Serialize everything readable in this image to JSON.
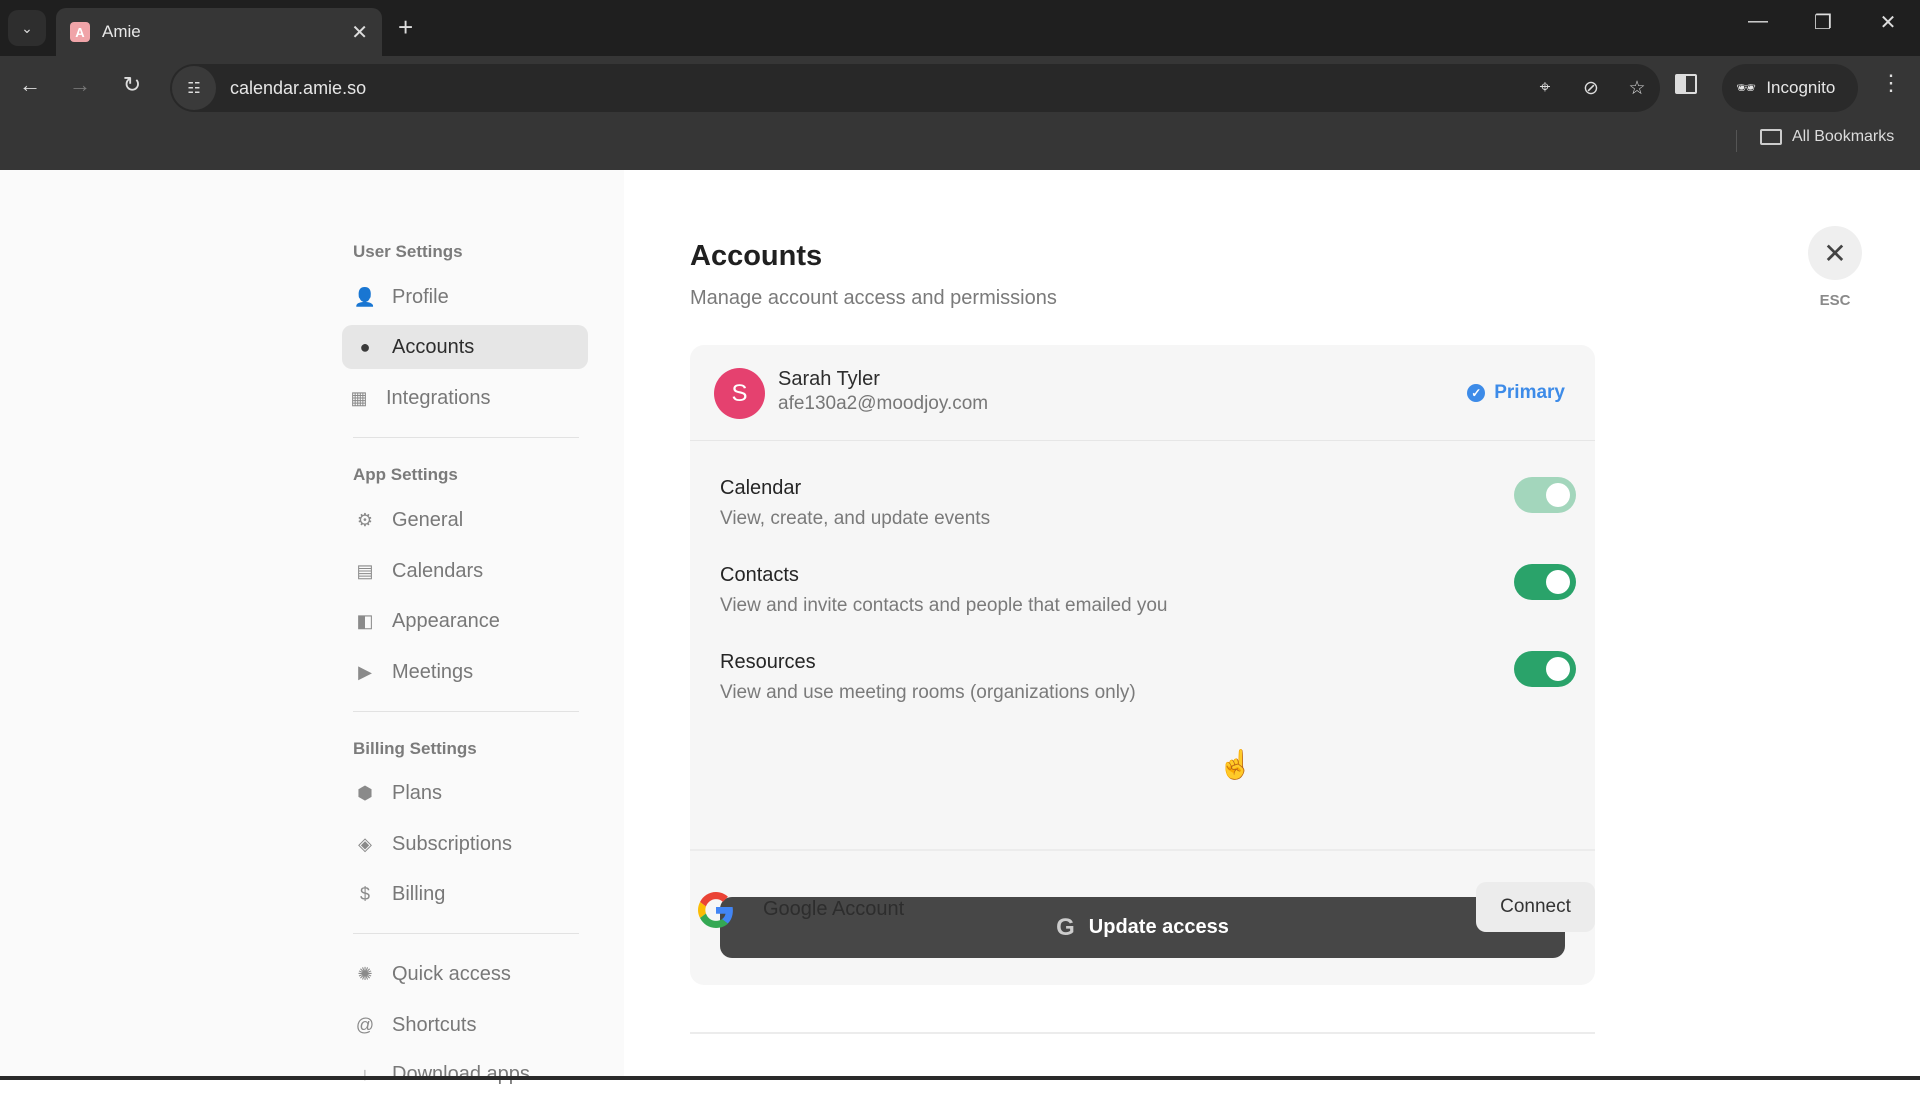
{
  "browser": {
    "tab_title": "Amie",
    "favicon_letter": "A",
    "url": "calendar.amie.so",
    "incognito_label": "Incognito",
    "bookmarks_label": "All Bookmarks",
    "icons": {
      "tab_search": "chevron-down-icon",
      "new_tab": "+",
      "minimize": "—",
      "restore": "❐",
      "close": "✕",
      "back": "←",
      "forward": "→",
      "reload": "↻",
      "menu": "⋮"
    }
  },
  "sidebar": {
    "sections": [
      {
        "label": "User Settings",
        "items": [
          {
            "label": "Profile",
            "icon": "profile-icon",
            "glyph": "👤",
            "active": false
          },
          {
            "label": "Accounts",
            "icon": "accounts-icon",
            "glyph": "●",
            "active": true
          },
          {
            "label": "Integrations",
            "icon": "integrations-icon",
            "glyph": "▦",
            "active": false
          }
        ]
      },
      {
        "label": "App Settings",
        "items": [
          {
            "label": "General",
            "icon": "gear-icon",
            "glyph": "⚙",
            "active": false
          },
          {
            "label": "Calendars",
            "icon": "calendar-icon",
            "glyph": "▤",
            "active": false
          },
          {
            "label": "Appearance",
            "icon": "appearance-icon",
            "glyph": "◧",
            "active": false
          },
          {
            "label": "Meetings",
            "icon": "video-icon",
            "glyph": "▶",
            "active": false
          }
        ]
      },
      {
        "label": "Billing Settings",
        "items": [
          {
            "label": "Plans",
            "icon": "plans-icon",
            "glyph": "⬢",
            "active": false
          },
          {
            "label": "Subscriptions",
            "icon": "box-icon",
            "glyph": "◈",
            "active": false
          },
          {
            "label": "Billing",
            "icon": "dollar-icon",
            "glyph": "$",
            "active": false
          }
        ]
      },
      {
        "label": "",
        "items": [
          {
            "label": "Quick access",
            "icon": "quick-access-icon",
            "glyph": "✺",
            "active": false
          },
          {
            "label": "Shortcuts",
            "icon": "at-icon",
            "glyph": "@",
            "active": false
          },
          {
            "label": "Download apps",
            "icon": "download-icon",
            "glyph": "↓",
            "active": false
          }
        ]
      }
    ]
  },
  "main": {
    "title": "Accounts",
    "subtitle": "Manage account access and permissions",
    "close_label": "ESC",
    "account": {
      "avatar_letter": "S",
      "avatar_color": "#e5416f",
      "name": "Sarah Tyler",
      "email": "afe130a2@moodjoy.com",
      "badge": "Primary",
      "badge_color": "#3d8be8"
    },
    "permissions": [
      {
        "title": "Calendar",
        "description": "View, create, and update events",
        "enabled": true,
        "disabled": true
      },
      {
        "title": "Contacts",
        "description": "View and invite contacts and people that emailed you",
        "enabled": true,
        "disabled": false
      },
      {
        "title": "Resources",
        "description": "View and use meeting rooms (organizations only)",
        "enabled": true,
        "disabled": false
      }
    ],
    "update_button": "Update access",
    "google_account": {
      "label": "Google Account",
      "connect_button": "Connect"
    },
    "toggle_color": "#2aa36a"
  }
}
